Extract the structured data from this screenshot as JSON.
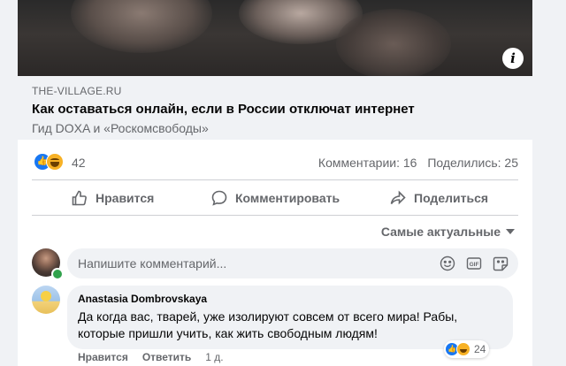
{
  "link_preview": {
    "domain": "THE-VILLAGE.RU",
    "title": "Как оставаться онлайн, если в России отключат интернет",
    "subtitle": "Гид DOXA и «Роскомсвободы»"
  },
  "stats": {
    "reaction_count": "42",
    "comments": "Комментарии: 16",
    "shares": "Поделились: 25"
  },
  "actions": {
    "like": "Нравится",
    "comment": "Комментировать",
    "share": "Поделиться"
  },
  "sort": {
    "label": "Самые актуальные"
  },
  "compose": {
    "placeholder": "Напишите комментарий..."
  },
  "comment": {
    "author": "Anastasia Dombrovskaya",
    "text": "Да когда вас, тварей, уже изолируют совсем от всего мира! Рабы, которые пришли учить, как жить свободным людям!",
    "reaction_count": "24",
    "like": "Нравится",
    "reply": "Ответить",
    "time": "1 д."
  },
  "colors": {
    "accent": "#1877f2",
    "muted_text": "#65676b",
    "bubble": "#f0f2f5"
  }
}
